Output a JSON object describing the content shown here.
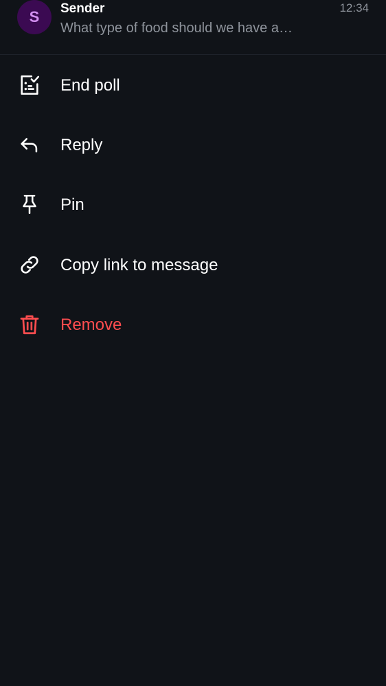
{
  "header": {
    "avatar_initial": "S",
    "sender": "Sender",
    "preview": "What type of food should we have a…",
    "time": "12:34"
  },
  "menu": {
    "end_poll": "End poll",
    "reply": "Reply",
    "pin": "Pin",
    "copy_link": "Copy link to message",
    "remove": "Remove"
  },
  "colors": {
    "background": "#101318",
    "text": "#ffffff",
    "danger": "#ff4d4f",
    "avatar_bg": "#3b0a52",
    "avatar_fg": "#d28ff0"
  }
}
